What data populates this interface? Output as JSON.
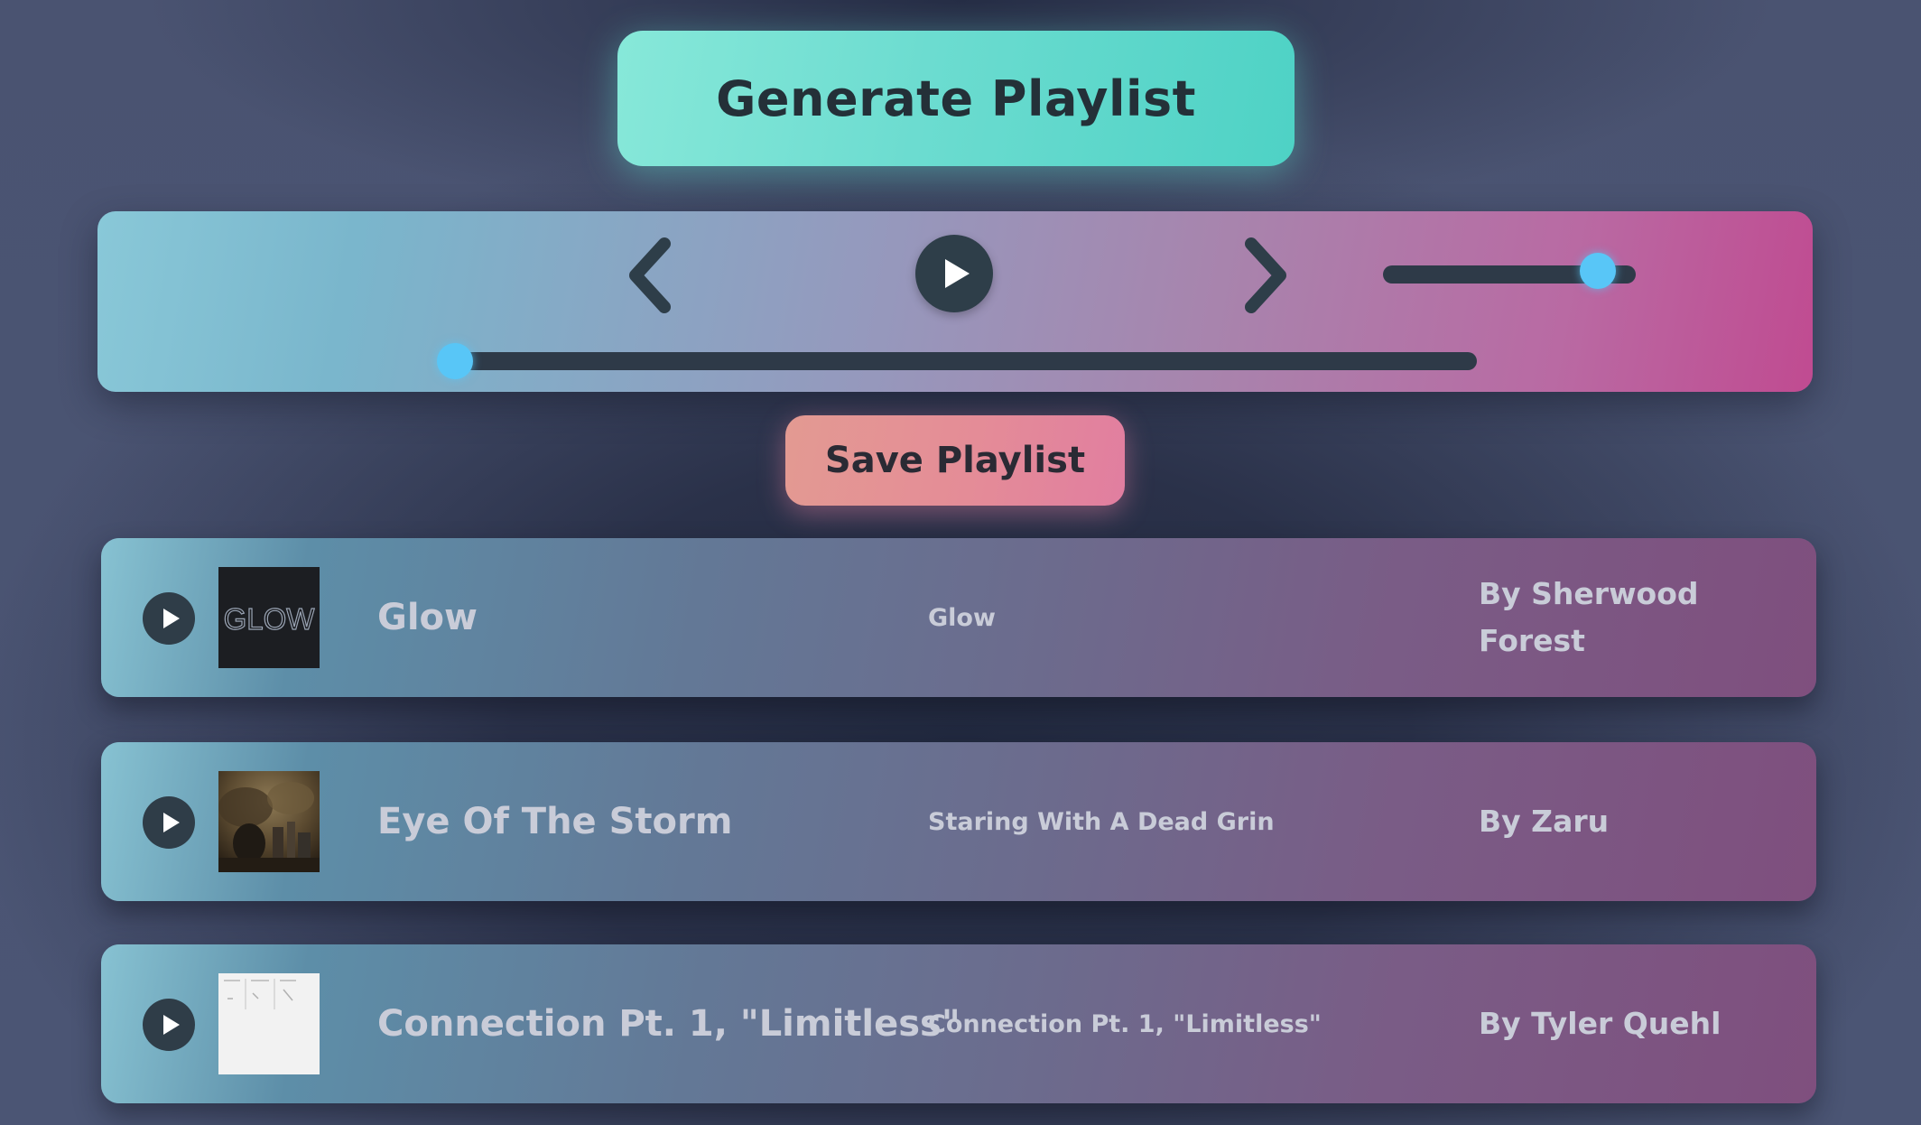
{
  "buttons": {
    "generate_label": "Generate Playlist",
    "save_label": "Save Playlist"
  },
  "player": {
    "controls": [
      "chevron-left-icon",
      "play-icon",
      "chevron-right-icon"
    ],
    "volume_level": 0.85,
    "progress_level": 0.0
  },
  "tracks": [
    {
      "title": "Glow",
      "album": "Glow",
      "artist": "By Sherwood Forest",
      "cover_text": "GLOW"
    },
    {
      "title": "Eye Of The Storm",
      "album": "Staring With A Dead Grin",
      "artist": "By Zaru"
    },
    {
      "title": "Connection Pt. 1, \"Limitless\"",
      "album": "Connection Pt. 1, \"Limitless\"",
      "artist": "By Tyler Quehl"
    }
  ],
  "colors": {
    "background": "#2a3149",
    "generate_accent": "#6cdcd0",
    "save_accent": "#e48c97",
    "slider_thumb": "#58c6f7",
    "player_gradient_start": "#89c8d8",
    "player_gradient_end": "#c04b91"
  }
}
